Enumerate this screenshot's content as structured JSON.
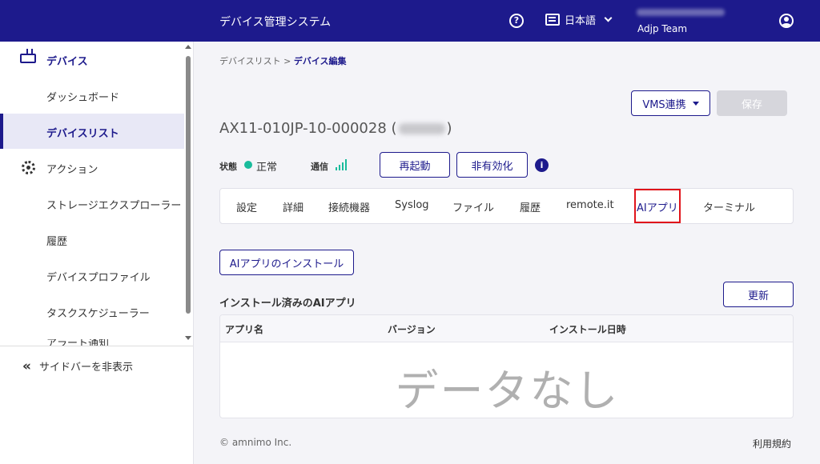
{
  "header": {
    "app_title": "デバイス管理システム",
    "help_icon": "?",
    "language": "日本語",
    "team": "Adjp Team"
  },
  "sidebar": {
    "items": [
      {
        "label": "デバイス",
        "icon": "router-icon"
      },
      {
        "label": "ダッシュボード"
      },
      {
        "label": "デバイスリスト"
      },
      {
        "label": "アクション",
        "icon": "gear-icon"
      },
      {
        "label": "ストレージエクスプローラー"
      },
      {
        "label": "履歴"
      },
      {
        "label": "デバイスプロファイル"
      },
      {
        "label": "タスクスケジューラー"
      },
      {
        "label": "アラート通知"
      }
    ],
    "hide_label": "サイドバーを非表示"
  },
  "breadcrumb": {
    "parent": "デバイスリスト",
    "separator": ">",
    "current": "デバイス編集"
  },
  "actions": {
    "vms_label": "VMS連携",
    "save_label": "保存"
  },
  "device": {
    "title_prefix": "AX11-010JP-10-000028 (",
    "title_suffix": ")"
  },
  "status": {
    "state_label": "状態",
    "state_value": "正常",
    "state_color": "#1abc9c",
    "comm_label": "通信",
    "restart_label": "再起動",
    "disable_label": "非有効化",
    "info_icon": "i"
  },
  "tabs": [
    "設定",
    "詳細",
    "接続機器",
    "Syslog",
    "ファイル",
    "履歴",
    "remote.it",
    "AIアプリ",
    "ターミナル"
  ],
  "ai_apps": {
    "install_label": "AIアプリのインストール",
    "section_title": "インストール済みのAIアプリ",
    "refresh_label": "更新",
    "columns": [
      "アプリ名",
      "バージョン",
      "インストール日時"
    ],
    "empty_text": "データなし"
  },
  "footer": {
    "copyright": "© amnimo Inc.",
    "terms": "利用規約"
  },
  "colors": {
    "brand": "#1d1a8c",
    "highlight": "#e0141b"
  }
}
